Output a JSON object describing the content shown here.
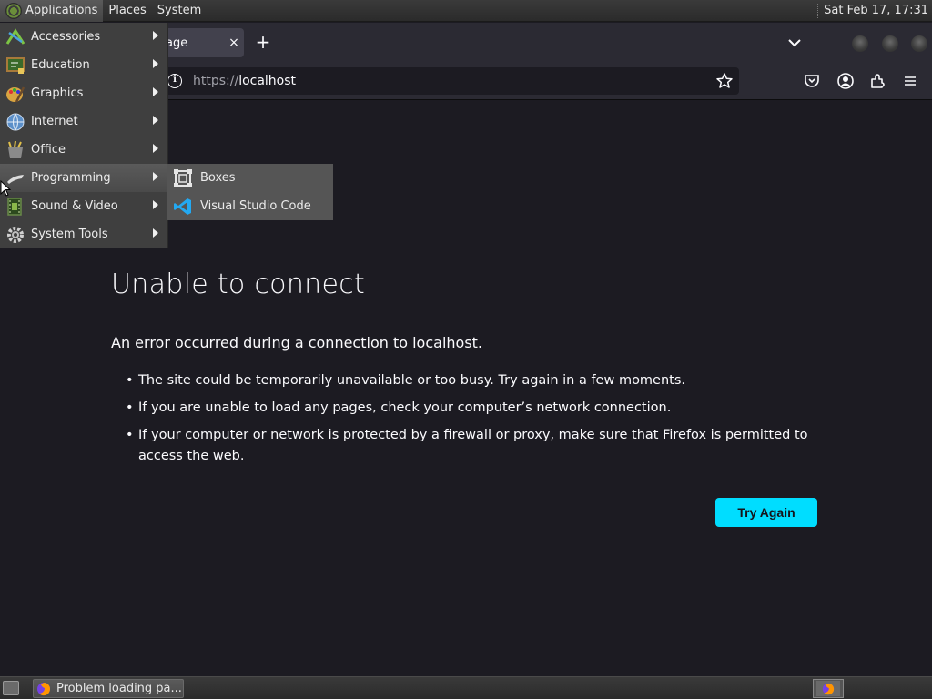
{
  "top_panel": {
    "menus": [
      "Applications",
      "Places",
      "System"
    ],
    "clock": "Sat Feb 17, 17:31"
  },
  "browser": {
    "tab": {
      "title": "age",
      "close": "×"
    },
    "new_tab": "+",
    "url_scheme": "https://",
    "url_host": "localhost"
  },
  "error_page": {
    "title": "Unable to connect",
    "subtitle": "An error occurred during a connection to localhost.",
    "bullets": [
      "The site could be temporarily unavailable or too busy. Try again in a few moments.",
      "If you are unable to load any pages, check your computer’s network connection.",
      "If your computer or network is protected by a firewall or proxy, make sure that Firefox is permitted to access the web."
    ],
    "try_again": "Try Again"
  },
  "apps_menu": {
    "items": [
      {
        "label": "Accessories",
        "icon": "accessories-icon"
      },
      {
        "label": "Education",
        "icon": "education-icon"
      },
      {
        "label": "Graphics",
        "icon": "graphics-icon"
      },
      {
        "label": "Internet",
        "icon": "internet-icon"
      },
      {
        "label": "Office",
        "icon": "office-icon"
      },
      {
        "label": "Programming",
        "icon": "programming-icon"
      },
      {
        "label": "Sound & Video",
        "icon": "sound-video-icon"
      },
      {
        "label": "System Tools",
        "icon": "system-tools-icon"
      }
    ],
    "submenu": [
      {
        "label": "Boxes",
        "icon": "boxes-icon"
      },
      {
        "label": "Visual Studio Code",
        "icon": "vscode-icon"
      }
    ]
  },
  "taskbar": {
    "task_label": "Problem loading pa..."
  },
  "colors": {
    "page_bg": "#1c1b22",
    "chrome_bg": "#2b2a33",
    "accent": "#00ddff",
    "menu_bg": "#3f3f3f"
  }
}
